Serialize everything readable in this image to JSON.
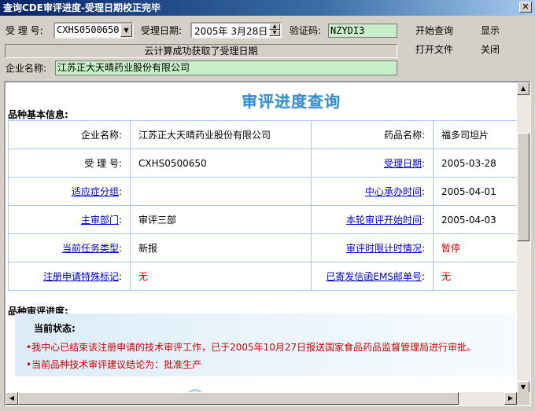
{
  "window": {
    "title": "查询CDE审评进度-受理日期校正完毕"
  },
  "form": {
    "accept_no_label": "受 理 号:",
    "accept_no_value": "CXHS0500650",
    "accept_date_label": "受理日期:",
    "accept_date_value": "2005年 3月28日",
    "captcha_label": "验证码:",
    "captcha_value": "NZYDI3",
    "status_message": "云计算成功获取了受理日期",
    "company_label": "企业名称:",
    "company_value": "江苏正大天晴药业股份有限公司"
  },
  "toolbar": {
    "start_query": "开始查询",
    "show": "显示",
    "open_file": "打开文件",
    "close": "关闭"
  },
  "page": {
    "title": "审评进度查询",
    "basic_info_heading": "品种基本信息:",
    "progress_heading": "品种审评进度:",
    "rows": [
      {
        "k1": "企业名称:",
        "v1": "江苏正大天晴药业股份有限公司",
        "k2": "药品名称:",
        "v2": "福多司坦片"
      },
      {
        "k1": "受 理 号:",
        "v1": "CXHS0500650",
        "k2": "受理日期",
        "v2": "2005-03-28"
      },
      {
        "k1": "适应症分组",
        "v1": "",
        "k2": "中心承办时间",
        "v2": "2005-04-01"
      },
      {
        "k1": "主审部门",
        "v1": "审评三部",
        "k2": "本轮审评开始时间",
        "v2": "2005-04-03"
      },
      {
        "k1": "当前任务类型",
        "v1": "新报",
        "k2": "审评时限计时情况",
        "v2": "暂停"
      },
      {
        "k1": "注册申请特殊标记",
        "v1": "无",
        "k2": "已寄发信函EMS邮单号",
        "v2": "无"
      }
    ],
    "current_status_title": "当前状态:",
    "status_line_1": "•我中心已结束该注册申请的技术审评工作，已于2005年10月27日报送国家食品药品监督管理局进行审批。",
    "status_line_2": "•当前品种技术审评建议结论为：批准生产"
  },
  "icons": {
    "close": "close-icon",
    "dropdown": "chevron-down-icon",
    "spin_up": "chevron-up-icon",
    "spin_down": "chevron-down-icon"
  },
  "colors": {
    "title_blue": "#3a8fc8",
    "link_blue": "#0000cc",
    "alert_red": "#d00000",
    "input_green": "#c8f0c8"
  }
}
